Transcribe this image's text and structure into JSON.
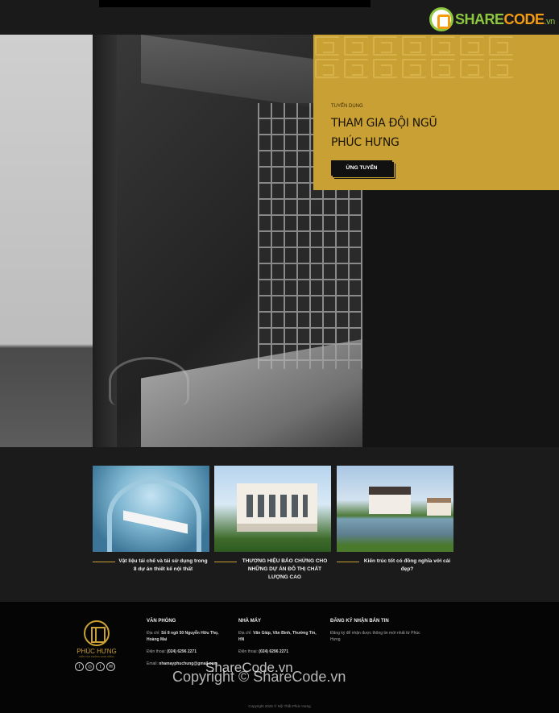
{
  "watermark_logo": {
    "share": "SHARE",
    "code": "CODE",
    "vn": ".vn"
  },
  "careers": {
    "eyebrow": "Tuyển dụng",
    "title_line1": "THAM GIA ĐỘI NGŨ",
    "title_line2": "PHÚC HƯNG",
    "button": "Ứng tuyển"
  },
  "news": [
    {
      "caption": "Vật liệu tái chế và tái sử dụng trong 8 dự án thiết kế nội thất"
    },
    {
      "caption": "THƯƠNG HIỆU BẢO CHỨNG CHO NHỮNG DỰ ÁN ĐÔ THỊ CHẤT LƯỢNG CAO"
    },
    {
      "caption": "Kiến trúc tốt có đồng nghĩa với cái đẹp?"
    }
  ],
  "footer": {
    "brand_name": "PHÚC HƯNG",
    "brand_tag": "KIẾN TẠO KHÔNG GIAN SỐNG",
    "office": {
      "heading": "VĂN PHÒNG",
      "address_label": "Địa chỉ:",
      "address": "Số 8 ngõ 50 Nguyễn Hữu Thọ, Hoàng Mai",
      "phone_label": "Điện thoại:",
      "phone": "(024) 6296 2271",
      "email_label": "Email:",
      "email": "nhamayphuchung@gmail.com"
    },
    "factory": {
      "heading": "NHÀ MÁY",
      "address_label": "Địa chỉ:",
      "address": "Văn Giáp, Văn Bình, Thường Tín, HN",
      "phone_label": "Điện thoại:",
      "phone": "(024) 6296 2271"
    },
    "newsletter": {
      "heading": "ĐĂNG KÝ NHẬN BẢN TIN",
      "text": "Đăng ký để nhận được thông tin mới nhất từ Phúc Hưng"
    },
    "social": [
      "f",
      "◎",
      "t",
      "✉"
    ],
    "copyright": "Copyright 2025 © Nội Thất Phúc Hưng"
  },
  "watermarks": {
    "line1": "ShareCode.vn",
    "line2": "Copyright © ShareCode.vn"
  }
}
